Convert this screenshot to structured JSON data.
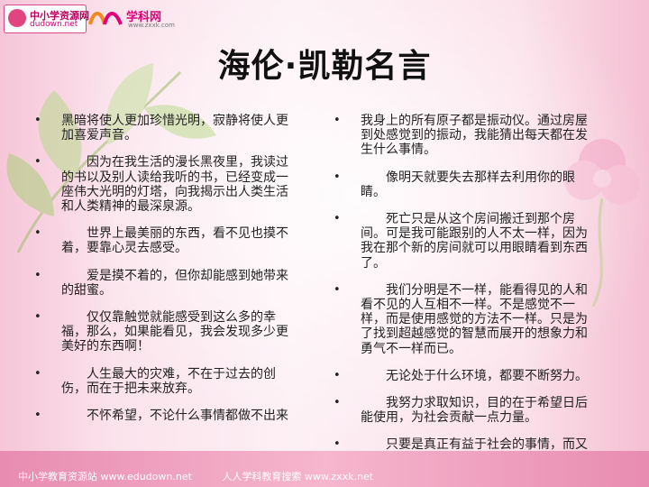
{
  "logos": {
    "logo1_cn": "中小学资源网",
    "logo1_en": "dudown.net",
    "logo2_cn": "学科网",
    "logo2_en": "www.zxxk.com"
  },
  "title": "海伦·凯勒名言",
  "left_items": [
    "黑暗将使人更加珍惜光明，寂静将使人更加喜爱声音。",
    "　　因为在我生活的漫长黑夜里，我读过的书以及别人读给我听的书，已经变成一座伟大光明的灯塔，向我揭示出人类生活和人类精神的最深泉源。",
    "　　世界上最美丽的东西，看不见也摸不着，要靠心灵去感受。",
    "　　爱是摸不着的，但你却能感到她带来的甜蜜。",
    "　　仅仅靠触觉就能感受到这么多的幸福，那么，如果能看见，我会发现多少更美好的东西啊！",
    "　　人生最大的灾难，不在于过去的创伤，而在于把未来放弃。",
    "　　不怀希望，不论什么事情都做不出来"
  ],
  "right_items": [
    "我身上的所有原子都是振动仪。通过房屋到处感觉到的振动，我能猜出每天都在发生什么事情。",
    "　　像明天就要失去那样去利用你的眼睛。",
    "　　死亡只是从这个房间搬迁到那个房间。可是我可能跟别的人不太一样，因为我在那个新的房间就可以用眼睛看到东西了。",
    "　　我们分明是不一样，能看得见的人和看不见的人互相不一样。不是感觉不一样，而是使用感觉的方法不一样。只是为了找到超越感觉的智慧而展开的想象力和勇气不一样而已。",
    "　　无论处于什么环境，都要不断努力。",
    "　　我努力求取知识，目的在于希望日后能使用，为社会贡献一点力量。",
    "　　只要是真正有益于社会的事情，而又是我能做的，我都将全力以赴。"
  ],
  "bullet_char": "•",
  "footer": {
    "left": "中小学教育资源站 www.edudown.net",
    "right": "人人学科教育搜索 www.zxxk.net"
  }
}
